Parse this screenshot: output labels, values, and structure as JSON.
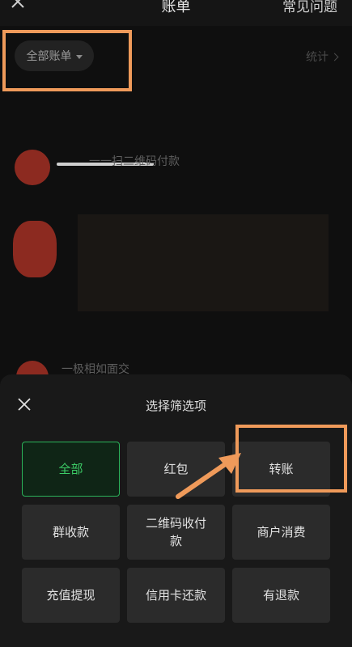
{
  "header": {
    "title": "账单",
    "faq_label": "常见问题",
    "close_icon": "close-icon"
  },
  "toolbar": {
    "filter_label": "全部账单",
    "stats_label": "统计"
  },
  "background_list": {
    "month_label": "",
    "items": [
      {
        "text": "一一扫二维码付款",
        "amount": ""
      },
      {
        "text": "",
        "amount": ""
      },
      {
        "text": "一极相如面交",
        "amount": ""
      }
    ]
  },
  "sheet": {
    "title": "选择筛选项",
    "options": [
      {
        "label": "全部",
        "selected": true
      },
      {
        "label": "红包",
        "selected": false
      },
      {
        "label": "转账",
        "selected": false
      },
      {
        "label": "群收款",
        "selected": false
      },
      {
        "label": "二维码收付款",
        "selected": false
      },
      {
        "label": "商户消费",
        "selected": false
      },
      {
        "label": "充值提现",
        "selected": false
      },
      {
        "label": "信用卡还款",
        "selected": false
      },
      {
        "label": "有退款",
        "selected": false
      }
    ]
  },
  "colors": {
    "accent_green": "#3ccb66",
    "annotation_orange": "#ef9a5a",
    "sheet_background": "#191919"
  }
}
